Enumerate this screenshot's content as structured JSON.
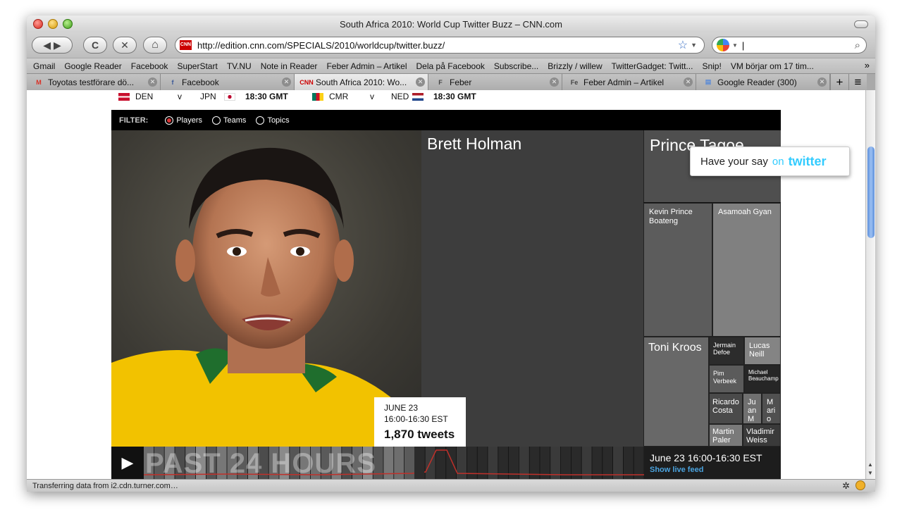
{
  "window": {
    "title": "South Africa 2010: World Cup Twitter Buzz – CNN.com"
  },
  "navbar": {
    "back_label": "◀ ▶",
    "reload_label": "C",
    "stop_label": "✕",
    "home_label": "⌂",
    "url": "http://edition.cnn.com/SPECIALS/2010/worldcup/twitter.buzz/",
    "url_favicon": "CNN",
    "bookmark_star": "☆",
    "search_value": "|",
    "search_glass": "⌕"
  },
  "bookmarks": [
    "Gmail",
    "Google Reader",
    "Facebook",
    "SuperStart",
    "TV.NU",
    "Note in Reader",
    "Feber Admin – Artikel",
    "Dela på Facebook",
    "Subscribe...",
    "Brizzly / willew",
    "TwitterGadget: Twitt...",
    "Snip!",
    "VM börjar om 17 tim..."
  ],
  "bookmarks_more": "»",
  "tabs": [
    {
      "label": "Toyotas testförare dö...",
      "fav": "M",
      "favcolor": "#d93025",
      "active": false
    },
    {
      "label": "Facebook",
      "fav": "f",
      "favcolor": "#3b5998",
      "active": false
    },
    {
      "label": "South Africa 2010: Wo...",
      "fav": "CNN",
      "favcolor": "#cc0000",
      "active": true
    },
    {
      "label": "Feber",
      "fav": "F",
      "favcolor": "#444",
      "active": false
    },
    {
      "label": "Feber Admin – Artikel",
      "fav": "Fe",
      "favcolor": "#444",
      "active": false
    },
    {
      "label": "Google Reader (300)",
      "fav": "▤",
      "favcolor": "#5b8bd6",
      "active": false
    }
  ],
  "tab_close": "✕",
  "tab_plus": "+",
  "matches": [
    {
      "home": "DEN",
      "vs": "v",
      "away": "JPN",
      "time": "18:30 GMT"
    },
    {
      "home": "CMR",
      "vs": "v",
      "away": "NED",
      "time": "18:30 GMT"
    }
  ],
  "filter": {
    "label": "FILTER:",
    "options": [
      "Players",
      "Teams",
      "Topics"
    ],
    "selected": "Players"
  },
  "twitter_box": {
    "text": "Have your say",
    "on": "on",
    "brand": "twitter"
  },
  "treemap": [
    {
      "name": "Brett Holman"
    },
    {
      "name": "Prince Tagoe"
    },
    {
      "name": "Kevin Prince Boateng"
    },
    {
      "name": "Asamoah Gyan"
    },
    {
      "name": "Toni Kroos"
    },
    {
      "name": "Jermain Defoe"
    },
    {
      "name": "Lucas Neill"
    },
    {
      "name": "Pim Verbeek"
    },
    {
      "name": "Michael Beauchamp"
    },
    {
      "name": "Ricardo Costa"
    },
    {
      "name": "Juan M"
    },
    {
      "name": "Mario G"
    },
    {
      "name": "Martin Paler"
    },
    {
      "name": "Vladimir Weiss"
    }
  ],
  "tooltip": {
    "date": "JUNE 23",
    "time": "16:00-16:30 EST",
    "tweets": "1,870 tweets"
  },
  "timeline": {
    "label": "PAST 24 HOURS",
    "play": "▶",
    "current": "June 23 16:00-16:30 EST",
    "live": "Show live feed"
  },
  "status": {
    "text": "Transferring data from i2.cdn.turner.com…"
  },
  "colors": {
    "cnn_red": "#cc0000",
    "twitter_blue": "#33ccff",
    "timeline_line": "#c0302a",
    "radio_on": "#dd3333",
    "link_blue": "#4aa3df"
  }
}
